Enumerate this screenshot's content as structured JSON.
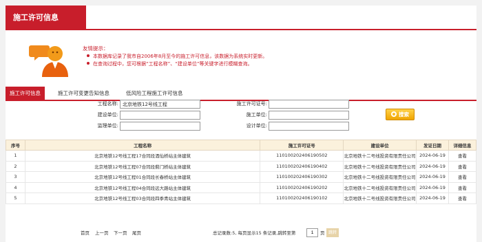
{
  "header": {
    "title": "施工许可信息"
  },
  "tips": {
    "title": "友情提示：",
    "items": [
      "本数据库记录了我市自2006年8月至今的施工许可信息，该数据为系统实时更新。",
      "在查询过程中，您可根据“工程名称”、“建设单位”等关键字进行模糊查询。"
    ]
  },
  "tabs": [
    "施工许可信息",
    "施工许可变更告知信息",
    "低风险工程施工许可信息"
  ],
  "search": {
    "project_name_label": "工程名称:",
    "project_name_value": "北京地铁12号线工程",
    "permit_no_label": "施工许可证号:",
    "builder_label": "建设单位:",
    "construction_label": "施工单位:",
    "supervisor_label": "监理单位:",
    "design_label": "设计单位:",
    "query_button": "搜索"
  },
  "table": {
    "columns": [
      "序号",
      "工程名称",
      "施工许可证号",
      "建设单位",
      "发证日期",
      "详细信息"
    ],
    "rows": [
      [
        "1",
        "北京地铁12号线工程17合同段酒仙桥站主体建筑",
        "110100202406190502",
        "北京地铁十二号线投资有限责任公司",
        "2024-06-19",
        "查看"
      ],
      [
        "2",
        "北京地铁12号线工程07合同段蓟门桥站主体建筑",
        "110100202406190402",
        "北京地铁十二号线投资有限责任公司",
        "2024-06-19",
        "查看"
      ],
      [
        "3",
        "北京地铁12号线工程01合同段长春桥站主体建筑",
        "110100202406190302",
        "北京地铁十二号线投资有限责任公司",
        "2024-06-19",
        "查看"
      ],
      [
        "4",
        "北京地铁12号线工程04合同段远大路站主体建筑",
        "110100202406190202",
        "北京地铁十二号线投资有限责任公司",
        "2024-06-19",
        "查看"
      ],
      [
        "5",
        "北京地铁12号线工程03合同段四季青站主体建筑",
        "110100202406190102",
        "北京地铁十二号线投资有限责任公司",
        "2024-06-19",
        "查看"
      ]
    ]
  },
  "pager": {
    "first": "首页",
    "prev": "上一页",
    "next": "下一页",
    "last": "尾页",
    "summary": "总记录数:5, 每页显示15 条记录,跳转至第",
    "page_value": "1",
    "page_unit": "页",
    "go": "跳转"
  },
  "colors": {
    "accent": "#c81e2b",
    "header_bg": "#fbf1dc",
    "button": "#f0a400"
  },
  "icons": {
    "avatar": "user-avatar-icon",
    "query": "search-icon"
  }
}
